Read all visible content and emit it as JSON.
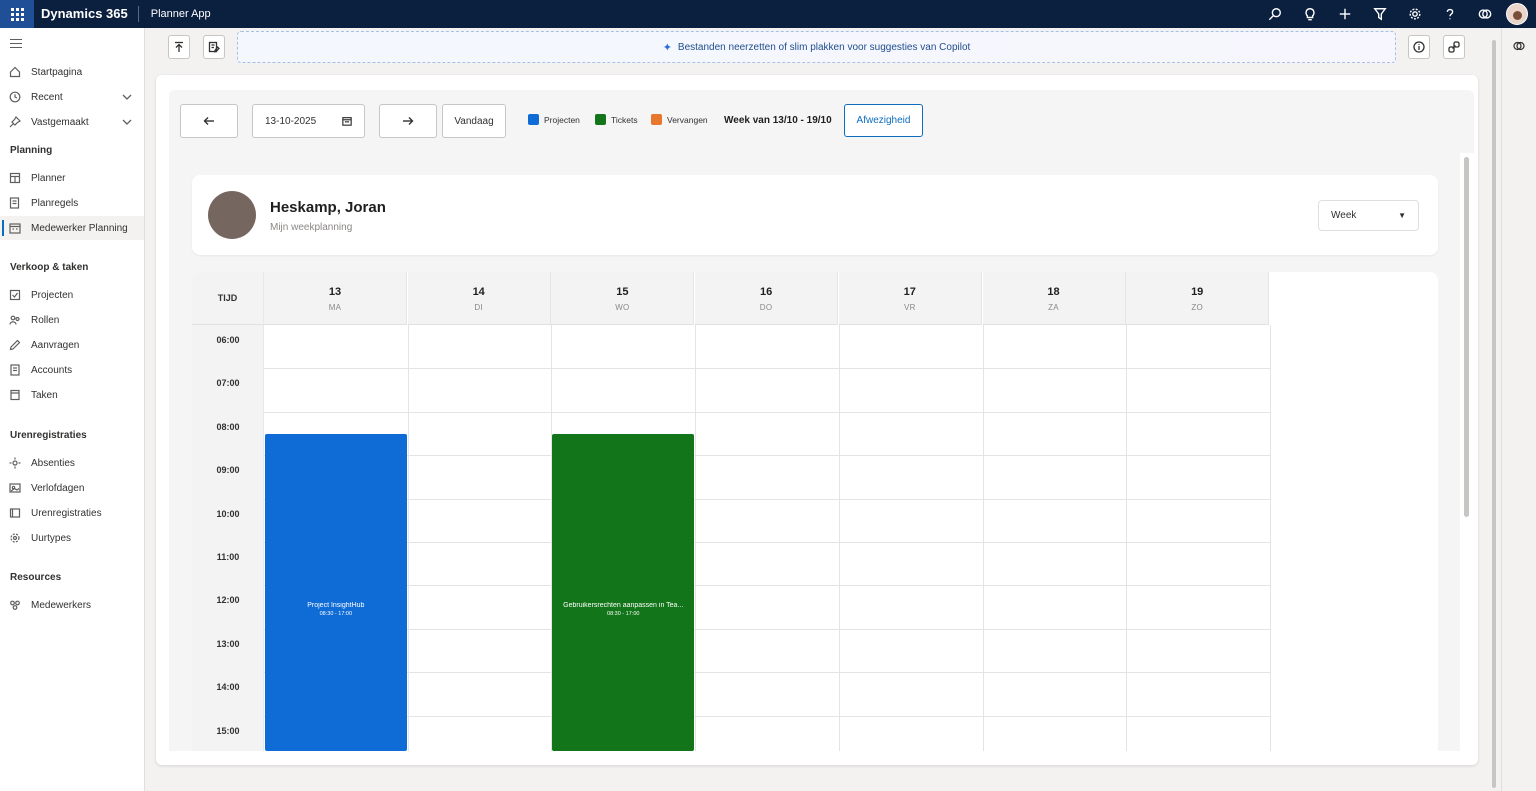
{
  "topbar": {
    "brand": "Dynamics 365",
    "app_name": "Planner App"
  },
  "sidebar": {
    "items": [
      {
        "label": "Startpagina"
      },
      {
        "label": "Recent"
      },
      {
        "label": "Vastgemaakt"
      }
    ],
    "sections": [
      {
        "title": "Planning",
        "items": [
          {
            "label": "Planner"
          },
          {
            "label": "Planregels"
          },
          {
            "label": "Medewerker Planning",
            "active": true
          }
        ]
      },
      {
        "title": "Verkoop & taken",
        "items": [
          {
            "label": "Projecten"
          },
          {
            "label": "Rollen"
          },
          {
            "label": "Aanvragen"
          },
          {
            "label": "Accounts"
          },
          {
            "label": "Taken"
          }
        ]
      },
      {
        "title": "Urenregistraties",
        "items": [
          {
            "label": "Absenties"
          },
          {
            "label": "Verlofdagen"
          },
          {
            "label": "Urenregistraties"
          },
          {
            "label": "Uurtypes"
          }
        ]
      },
      {
        "title": "Resources",
        "items": [
          {
            "label": "Medewerkers"
          }
        ]
      }
    ]
  },
  "copilot": {
    "drop_text": "Bestanden neerzetten of slim plakken voor suggesties van Copilot"
  },
  "toolbar": {
    "date_value": "13-10-2025",
    "today_label": "Vandaag",
    "legend": [
      {
        "label": "Projecten",
        "color": "#0f6cd6"
      },
      {
        "label": "Tickets",
        "color": "#13751a"
      },
      {
        "label": "Vervangen",
        "color": "#e8772e"
      }
    ],
    "week_label": "Week van 13/10 - 19/10",
    "absence_label": "Afwezigheid"
  },
  "profile": {
    "name": "Heskamp, Joran",
    "subtitle": "Mijn weekplanning",
    "view_selected": "Week"
  },
  "calendar": {
    "time_header": "TIJD",
    "days": [
      {
        "num": "13",
        "name": "MA"
      },
      {
        "num": "14",
        "name": "DI"
      },
      {
        "num": "15",
        "name": "WO"
      },
      {
        "num": "16",
        "name": "DO"
      },
      {
        "num": "17",
        "name": "VR"
      },
      {
        "num": "18",
        "name": "ZA"
      },
      {
        "num": "19",
        "name": "ZO"
      }
    ],
    "times": [
      "06:00",
      "07:00",
      "08:00",
      "09:00",
      "10:00",
      "11:00",
      "12:00",
      "13:00",
      "14:00",
      "15:00"
    ],
    "events": [
      {
        "title": "Project InsightHub",
        "time": "08:30 - 17:00",
        "day": 0,
        "start": 8.5,
        "color": "#0f6cd6"
      },
      {
        "title": "Gebruikersrechten aanpassen in Tea...",
        "time": "08:30 - 17:00",
        "day": 2,
        "start": 8.5,
        "color": "#13751a"
      }
    ]
  }
}
